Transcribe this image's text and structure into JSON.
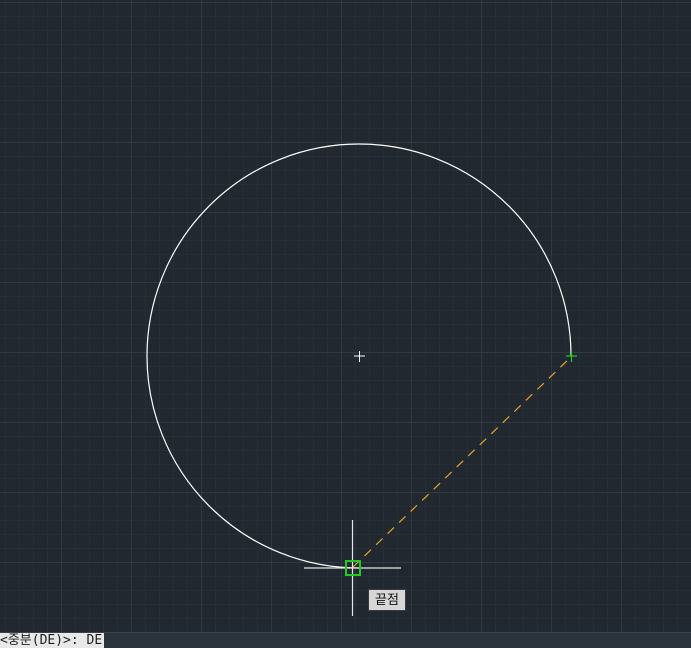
{
  "drawing": {
    "background_color": "#212830",
    "grid_minor_color": "#262e38",
    "grid_major_color": "#2f3944",
    "geometry_color": "#ffffff",
    "rubberband_color": "#e0a626",
    "snap_marker_color": "#22cc22",
    "crosshair_color": "#e6e6e6",
    "objects": [
      "circle-arc",
      "center-mark",
      "rubberband-line",
      "arc-endpoint-grip",
      "osnap-endpoint-marker",
      "crosshair-cursor"
    ]
  },
  "osnap_tooltip": {
    "label": "끝점"
  },
  "command_line": {
    "prompt_text": "<중분(DE)>: DE"
  }
}
